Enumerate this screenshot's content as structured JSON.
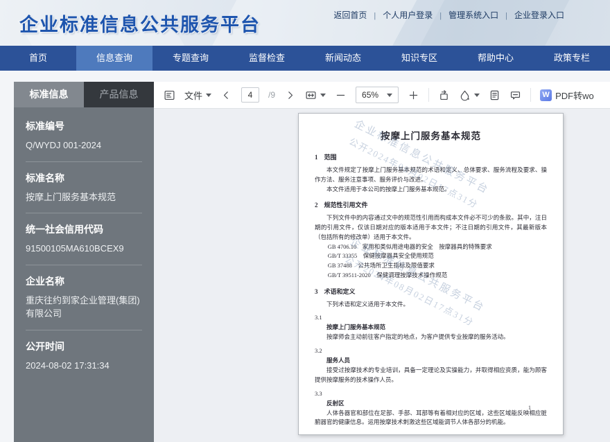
{
  "header": {
    "title": "企业标准信息公共服务平台",
    "links": [
      "返回首页",
      "个人用户登录",
      "管理系统入口",
      "企业登录入口"
    ]
  },
  "nav": {
    "items": [
      {
        "label": "首页",
        "active": false
      },
      {
        "label": "信息查询",
        "active": true
      },
      {
        "label": "专题查询",
        "active": false
      },
      {
        "label": "监督检查",
        "active": false
      },
      {
        "label": "新闻动态",
        "active": false
      },
      {
        "label": "知识专区",
        "active": false
      },
      {
        "label": "帮助中心",
        "active": false
      },
      {
        "label": "政策专栏",
        "active": false
      }
    ]
  },
  "colors": {
    "nav_bg": "#2c5298",
    "nav_active": "#4e7abd",
    "sidebar_bg": "#6f767d",
    "sidebar_tab_inactive": "#34383d",
    "title_blue": "#1e55ae",
    "viewer_bg": "#edeff3"
  },
  "sidebar": {
    "tabs": [
      {
        "label": "标准信息",
        "active": true
      },
      {
        "label": "产品信息",
        "active": false
      }
    ],
    "fields": [
      {
        "label": "标准编号",
        "value": "Q/WYDJ 001-2024"
      },
      {
        "label": "标准名称",
        "value": "按摩上门服务基本规范"
      },
      {
        "label": "统一社会信用代码",
        "value": "91500105MA610BCEX9"
      },
      {
        "label": "企业名称",
        "value": "重庆往约到家企业管理(集团)有限公司"
      },
      {
        "label": "公开时间",
        "value": "2024-08-02 17:31:34"
      }
    ]
  },
  "toolbar": {
    "file_menu_label": "文件",
    "page_current": "4",
    "page_total": "/9",
    "zoom_level": "65%",
    "word_badge": "W",
    "convert_label": "PDF转wo",
    "icons": [
      "thumbnail-panel-icon",
      "chevron-left-icon",
      "chevron-right-icon",
      "fit-width-icon",
      "zoom-out-icon",
      "zoom-in-icon",
      "rotate-icon",
      "fill-color-icon",
      "notes-icon",
      "comment-icon",
      "word-icon"
    ]
  },
  "document": {
    "title": "按摩上门服务基本规范",
    "watermark": {
      "line1": "企业标准信息公共服务平台",
      "line2": "公开2024年08月02日17点31分"
    },
    "page_number": "1",
    "blocks": [
      {
        "type": "h2",
        "text": "1　范围"
      },
      {
        "type": "p",
        "text": "本文件规定了按摩上门服务基本规范的术语和定义、总体要求、服务流程及要求、操作方法、服务注意事项、服务评价与改进。"
      },
      {
        "type": "p",
        "text": "本文件适用于本公司的按摩上门服务基本规范。"
      },
      {
        "type": "h2",
        "text": "2　规范性引用文件"
      },
      {
        "type": "p",
        "text": "下列文件中的内容通过文中的规范性引用而构成本文件必不可少的条款。其中，注日期的引用文件，仅该日期对应的版本适用于本文件；不注日期的引用文件，其最新版本（包括所有的修改单）适用于本文件。"
      },
      {
        "type": "ref",
        "text": "GB 4706.10　家用和类似用途电器的安全　按摩器具的特殊要求"
      },
      {
        "type": "ref",
        "text": "GB/T 33355　保健按摩器具安全使用规范"
      },
      {
        "type": "ref",
        "text": "GB 37488　公共场所卫生指标及限值要求"
      },
      {
        "type": "ref",
        "text": "GB/T 39511-2020　保健调理按摩技术操作规范"
      },
      {
        "type": "h2",
        "text": "3　术语和定义"
      },
      {
        "type": "p",
        "text": "下列术语和定义适用于本文件。"
      },
      {
        "type": "num",
        "text": "3.1"
      },
      {
        "type": "term",
        "text": "按摩上门服务基本规范"
      },
      {
        "type": "p",
        "text": "按摩师会主动前往客户指定的地点，为客户提供专业按摩的服务活动。"
      },
      {
        "type": "num",
        "text": "3.2"
      },
      {
        "type": "term",
        "text": "服务人员"
      },
      {
        "type": "p",
        "text": "接受过按摩技术的专业培训，具备一定理论及实操能力，并取得相应资质，能为顾客提供按摩服务的技术操作人员。"
      },
      {
        "type": "num",
        "text": "3.3"
      },
      {
        "type": "term",
        "text": "反射区"
      },
      {
        "type": "p",
        "text": "人体各器官和部位在足部、手部、耳部等有着相对应的区域，这些区域能反映相应脏腑器官的健康信息。运用按摩技术刺激这些区域能调节人体各部分的机能。"
      }
    ]
  }
}
